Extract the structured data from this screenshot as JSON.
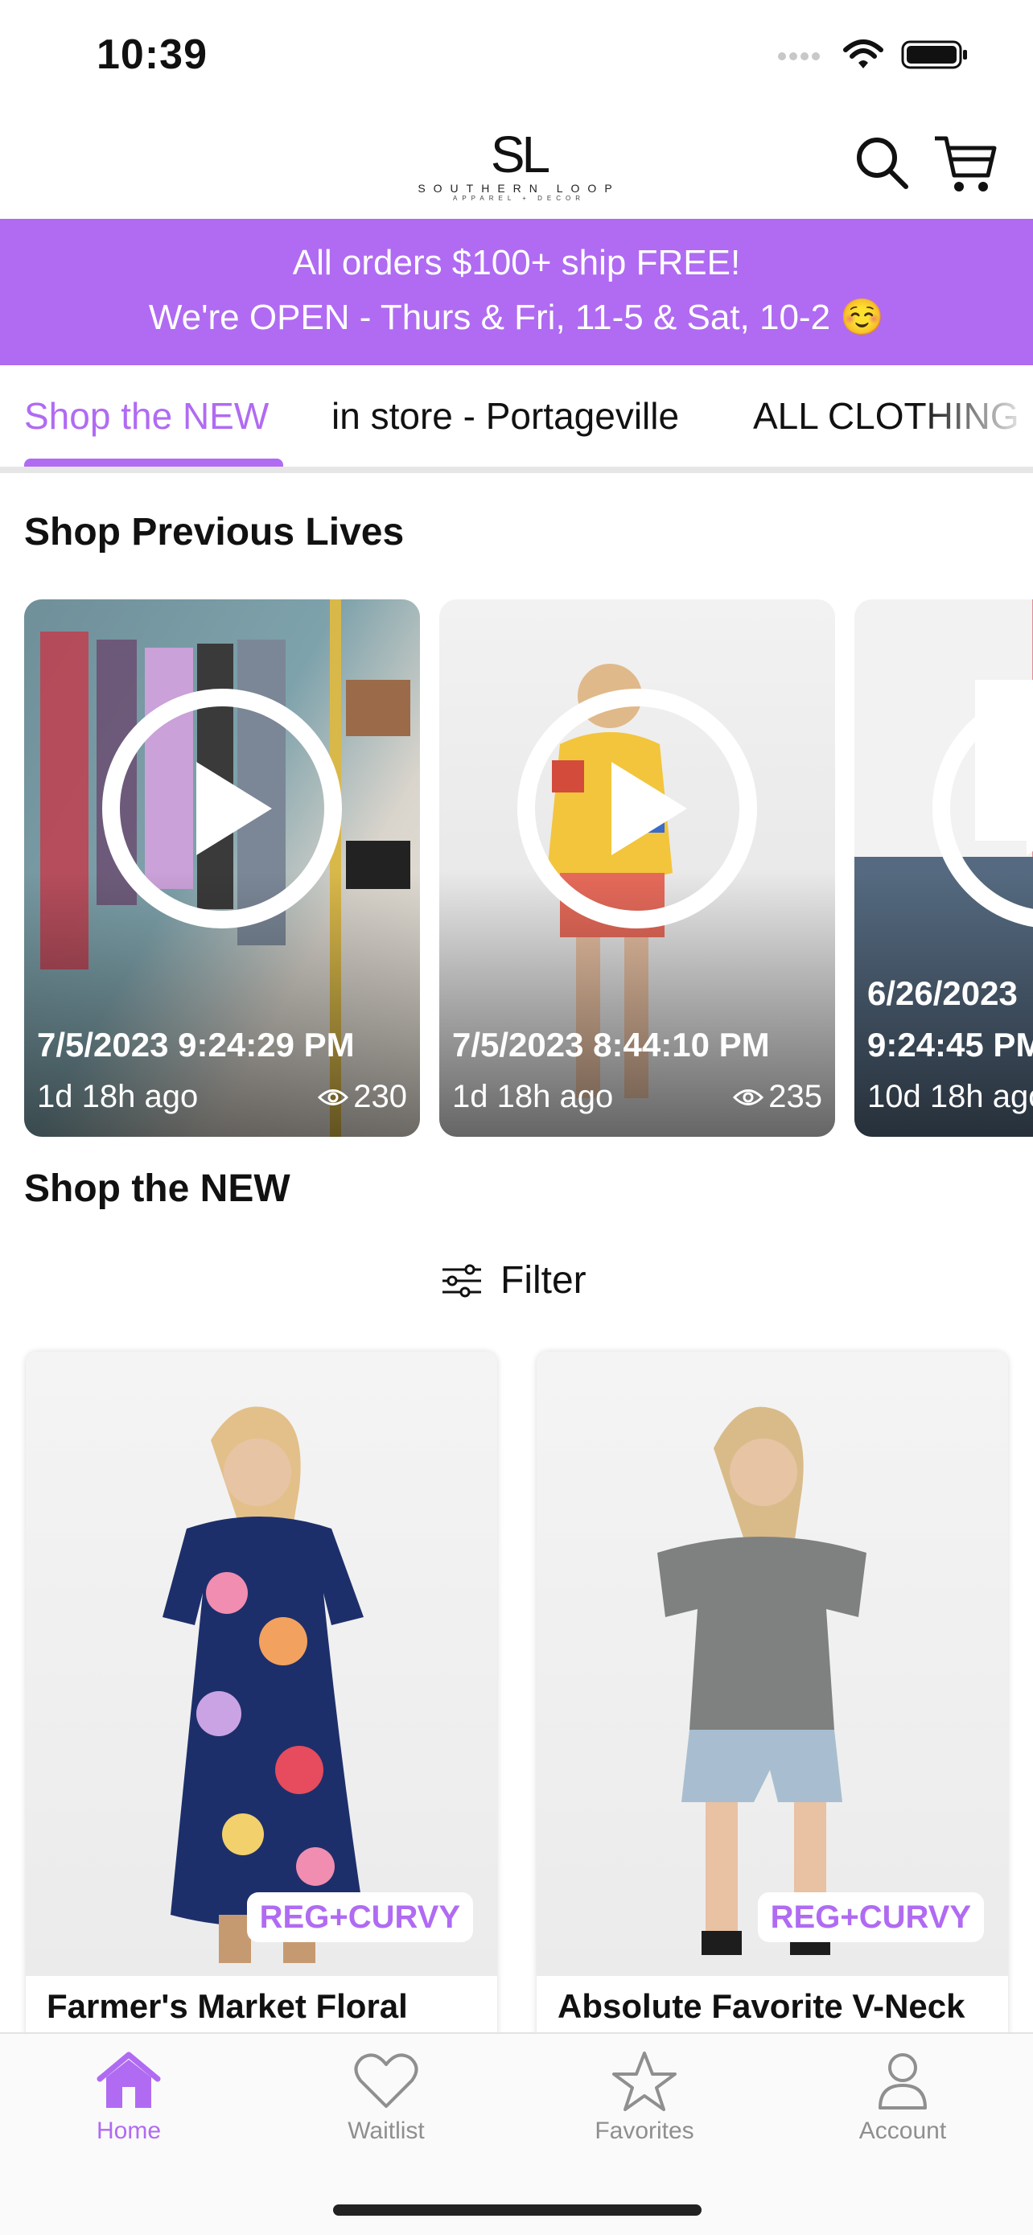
{
  "status_bar": {
    "time": "10:39"
  },
  "header": {
    "logo_mark": "SL",
    "logo_name": "SOUTHERN LOOP",
    "logo_tagline": "APPAREL + DECOR",
    "icons": [
      "search-icon",
      "cart-icon"
    ]
  },
  "banner": {
    "line1": "All orders $100+ ship FREE!",
    "line2": "We're OPEN - Thurs & Fri, 11-5 & Sat, 10-2 ☺️",
    "color": "#b06bf2"
  },
  "tabs": [
    {
      "label": "Shop the NEW",
      "active": true
    },
    {
      "label": "in store - Portageville",
      "active": false
    },
    {
      "label": "ALL CLOTHING",
      "active": false
    }
  ],
  "previous_lives": {
    "title": "Shop Previous Lives",
    "cards": [
      {
        "date": "7/5/2023 9:24:29 PM",
        "ago": "1d 18h ago",
        "views": "230"
      },
      {
        "date": "7/5/2023 8:44:10 PM",
        "ago": "1d 18h ago",
        "views": "235"
      },
      {
        "date_line1": "6/26/2023",
        "date_line2": "9:24:45 PM",
        "ago": "10d 18h ago"
      }
    ]
  },
  "new_section": {
    "title": "Shop the NEW",
    "filter_label": "Filter",
    "products": [
      {
        "name": "Farmer's Market Floral",
        "badge": "REG+CURVY"
      },
      {
        "name": "Absolute Favorite V-Neck",
        "badge": "REG+CURVY"
      }
    ]
  },
  "bottom_nav": [
    {
      "label": "Home",
      "icon": "home-icon",
      "active": true
    },
    {
      "label": "Waitlist",
      "icon": "heart-icon",
      "active": false
    },
    {
      "label": "Favorites",
      "icon": "star-icon",
      "active": false
    },
    {
      "label": "Account",
      "icon": "person-icon",
      "active": false
    }
  ],
  "colors": {
    "accent": "#b06bf2",
    "inactive": "#8f8f8f"
  }
}
